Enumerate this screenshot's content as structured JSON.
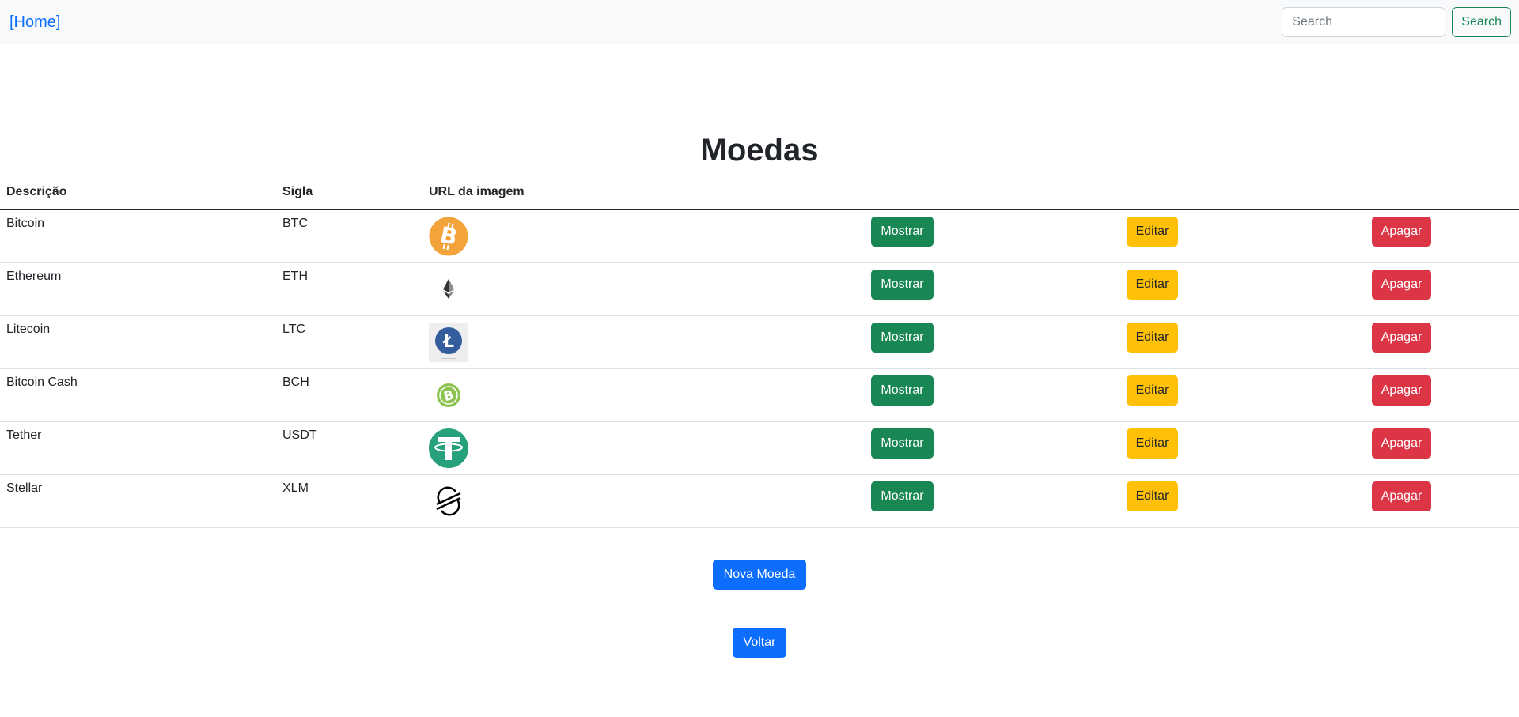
{
  "navbar": {
    "home_label": "[Home]",
    "search_placeholder": "Search",
    "search_button": "Search"
  },
  "page": {
    "title": "Moedas"
  },
  "table": {
    "headers": [
      "Descrição",
      "Sigla",
      "URL da imagem"
    ],
    "rows": [
      {
        "descricao": "Bitcoin",
        "sigla": "BTC",
        "icon": "bitcoin-logo-icon",
        "btn_show": "Mostrar",
        "btn_edit": "Editar",
        "btn_delete": "Apagar"
      },
      {
        "descricao": "Ethereum",
        "sigla": "ETH",
        "icon": "ethereum-logo-icon",
        "btn_show": "Mostrar",
        "btn_edit": "Editar",
        "btn_delete": "Apagar"
      },
      {
        "descricao": "Litecoin",
        "sigla": "LTC",
        "icon": "litecoin-logo-icon",
        "btn_show": "Mostrar",
        "btn_edit": "Editar",
        "btn_delete": "Apagar"
      },
      {
        "descricao": "Bitcoin Cash",
        "sigla": "BCH",
        "icon": "bitcoin-cash-logo-icon",
        "btn_show": "Mostrar",
        "btn_edit": "Editar",
        "btn_delete": "Apagar"
      },
      {
        "descricao": "Tether",
        "sigla": "USDT",
        "icon": "tether-logo-icon",
        "btn_show": "Mostrar",
        "btn_edit": "Editar",
        "btn_delete": "Apagar"
      },
      {
        "descricao": "Stellar",
        "sigla": "XLM",
        "icon": "stellar-logo-icon",
        "btn_show": "Mostrar",
        "btn_edit": "Editar",
        "btn_delete": "Apagar"
      }
    ]
  },
  "actions": {
    "nova_moeda": "Nova Moeda",
    "voltar": "Voltar"
  },
  "colors": {
    "primary": "#0d6efd",
    "success": "#198754",
    "warning": "#ffc107",
    "danger": "#dc3545",
    "navbar_bg": "#f8f9fa"
  }
}
